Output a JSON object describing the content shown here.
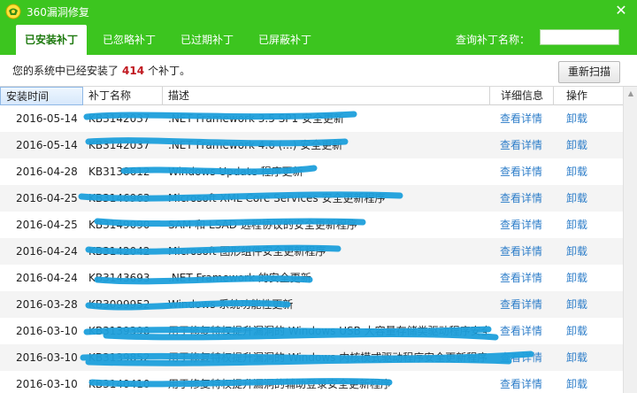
{
  "window": {
    "title": "360漏洞修复",
    "close_glyph": "✕"
  },
  "tabs": [
    {
      "label": "已安装补丁",
      "active": true
    },
    {
      "label": "已忽略补丁",
      "active": false
    },
    {
      "label": "已过期补丁",
      "active": false
    },
    {
      "label": "已屏蔽补丁",
      "active": false
    }
  ],
  "search": {
    "label": "查询补丁名称：",
    "value": ""
  },
  "status": {
    "prefix": "您的系统中已经安装了",
    "count": "414",
    "suffix": "个补丁。"
  },
  "rescan_label": "重新扫描",
  "table": {
    "columns": [
      "安装时间",
      "补丁名称",
      "描述",
      "详细信息",
      "操作"
    ],
    "sorted_column": "安装时间",
    "rows": [
      {
        "date": "2016-05-14",
        "kb": "KB3142037",
        "desc": ".NET Framework 3.5 SP1 安全更新",
        "detail": "查看详情",
        "op": "卸载"
      },
      {
        "date": "2016-05-14",
        "kb": "KB3142037",
        "desc": ".NET Framework 4.6 (...) 安全更新",
        "detail": "查看详情",
        "op": "卸载"
      },
      {
        "date": "2016-04-28",
        "kb": "KB3138612",
        "desc": "Windows Update 程序更新",
        "detail": "查看详情",
        "op": "卸载"
      },
      {
        "date": "2016-04-25",
        "kb": "KB3146963",
        "desc": "Microsoft XML Core Services 安全更新程序",
        "detail": "查看详情",
        "op": "卸载"
      },
      {
        "date": "2016-04-25",
        "kb": "KB3149090",
        "desc": "SAM 和 LSAD 远程协议的安全更新程序",
        "detail": "查看详情",
        "op": "卸载"
      },
      {
        "date": "2016-04-24",
        "kb": "KB3142042",
        "desc": "Microsoft 图形组件安全更新程序",
        "detail": "查看详情",
        "op": "卸载"
      },
      {
        "date": "2016-04-24",
        "kb": "KB3143693",
        "desc": ".NET Framework 的安全更新",
        "detail": "查看详情",
        "op": "卸载"
      },
      {
        "date": "2016-03-28",
        "kb": "KB3099952",
        "desc": "Windows 系统功能性更新",
        "detail": "查看详情",
        "op": "卸载"
      },
      {
        "date": "2016-03-10",
        "kb": "KB3139398",
        "desc": "用于修复特权提升漏洞的 Windows USB 大容量存储类驱动程序安全更新",
        "detail": "查看详情",
        "op": "卸载"
      },
      {
        "date": "2016-03-10",
        "kb": "KB3139852",
        "desc": "用于修复特权提升漏洞的 Windows 内核模式驱动程序安全更新程序",
        "detail": "查看详情",
        "op": "卸载"
      },
      {
        "date": "2016-03-10",
        "kb": "KB3140410",
        "desc": "用于修复特权提升漏洞的辅助登录安全更新程序",
        "detail": "查看详情",
        "op": "卸载"
      }
    ]
  },
  "icons": {
    "logo": "shield-logo-icon",
    "close": "close-icon",
    "scroll_up": "scroll-up-icon"
  },
  "colors": {
    "header": "#3cc51f",
    "link": "#2e7ec9",
    "count": "#c0171f",
    "scribble": "#1ea0dc"
  }
}
